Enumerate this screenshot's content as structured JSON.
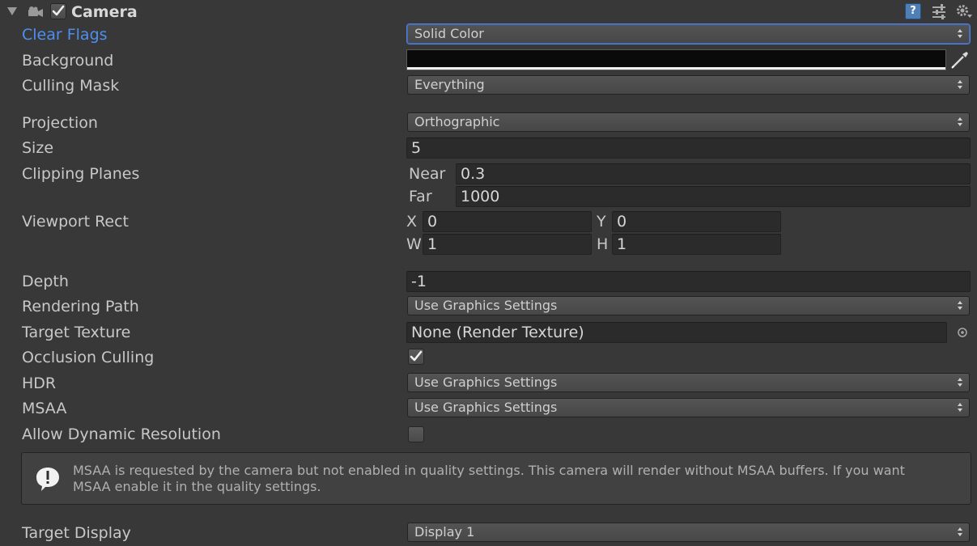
{
  "header": {
    "title": "Camera",
    "enabled": true
  },
  "fields": {
    "clear_flags": {
      "label": "Clear Flags",
      "value": "Solid Color"
    },
    "background": {
      "label": "Background",
      "color": "#0a0a0a"
    },
    "culling_mask": {
      "label": "Culling Mask",
      "value": "Everything"
    },
    "projection": {
      "label": "Projection",
      "value": "Orthographic"
    },
    "size": {
      "label": "Size",
      "value": "5"
    },
    "clipping_planes": {
      "label": "Clipping Planes",
      "near_label": "Near",
      "near": "0.3",
      "far_label": "Far",
      "far": "1000"
    },
    "viewport_rect": {
      "label": "Viewport Rect",
      "x_label": "X",
      "x": "0",
      "y_label": "Y",
      "y": "0",
      "w_label": "W",
      "w": "1",
      "h_label": "H",
      "h": "1"
    },
    "depth": {
      "label": "Depth",
      "value": "-1"
    },
    "rendering_path": {
      "label": "Rendering Path",
      "value": "Use Graphics Settings"
    },
    "target_texture": {
      "label": "Target Texture",
      "value": "None (Render Texture)"
    },
    "occlusion_culling": {
      "label": "Occlusion Culling",
      "checked": true
    },
    "hdr": {
      "label": "HDR",
      "value": "Use Graphics Settings"
    },
    "msaa": {
      "label": "MSAA",
      "value": "Use Graphics Settings"
    },
    "allow_dynamic_resolution": {
      "label": "Allow Dynamic Resolution",
      "checked": false
    },
    "target_display": {
      "label": "Target Display",
      "value": "Display 1"
    }
  },
  "warning": {
    "line1": "MSAA is requested by the camera but not enabled in quality settings. This camera will render without MSAA buffers. If you want",
    "line2": "MSAA enable it in the quality settings."
  },
  "colors": {
    "panel_bg": "#383838",
    "active_label": "#4d8ff0",
    "focus_border": "#3d68c2"
  },
  "icons": {
    "foldout": "triangle-down-icon",
    "component": "camera-icon",
    "help": "help-book-icon",
    "presets": "presets-icon",
    "settings": "gear-icon",
    "color_picker": "eyedropper-icon",
    "object_picker": "object-picker-icon",
    "warning": "warning-icon"
  }
}
